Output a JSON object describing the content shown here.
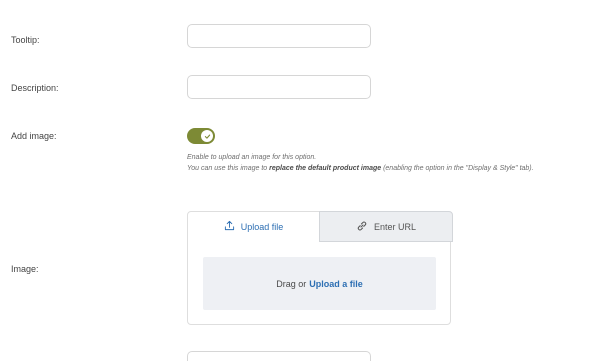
{
  "fields": {
    "tooltip": {
      "label": "Tooltip:",
      "value": ""
    },
    "description": {
      "label": "Description:",
      "value": ""
    },
    "add_image": {
      "label": "Add image:",
      "enabled": true,
      "help_line1": "Enable to upload an image for this option.",
      "help_line2_pre": "You can use this image to ",
      "help_line2_bold": "replace the default product image",
      "help_line2_post": " (enabling the option in the \"Display & Style\" tab)."
    },
    "image": {
      "label": "Image:",
      "tabs": {
        "upload": "Upload file",
        "url": "Enter URL"
      },
      "active_tab": "upload",
      "drop_prefix": "Drag or",
      "drop_link": "Upload a file"
    }
  },
  "colors": {
    "accent_toggle": "#7d8a35",
    "link_blue": "#2d6fb3",
    "drop_zone_bg": "#eef0f4"
  },
  "icons": {
    "upload_tab": "upload-arrow-icon",
    "url_tab": "link-icon",
    "toggle": "check-icon"
  }
}
